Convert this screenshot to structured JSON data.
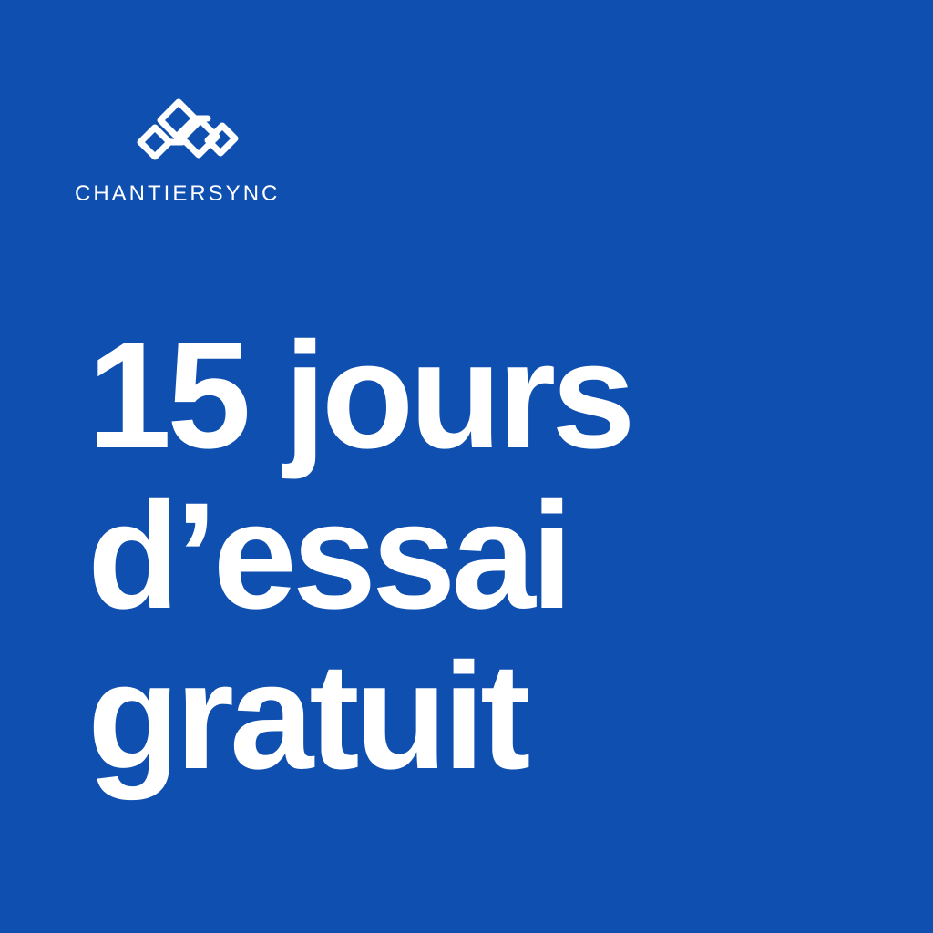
{
  "colors": {
    "background": "#0f4fb0",
    "foreground": "#ffffff"
  },
  "brand": {
    "logo_icon": "chantiersync-linked-chain-logo",
    "name": "CHANTIERSYNC"
  },
  "headline": {
    "lines": [
      "15 jours",
      "d’essai",
      "gratuit"
    ]
  }
}
